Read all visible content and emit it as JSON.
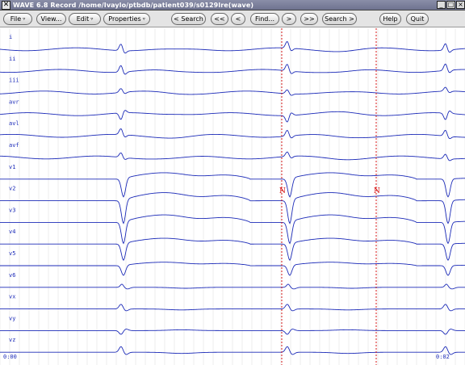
{
  "window": {
    "title": "WAVE 6.8  Record /home/Ivaylo/ptbdb/patient039/s0129lre(wave)",
    "app_icon": "x-logo-icon",
    "controls": [
      "minimize-icon",
      "maximize-icon",
      "close-icon"
    ]
  },
  "toolbar": {
    "file": "File",
    "view": "View...",
    "edit": "Edit",
    "properties": "Properties",
    "search_back": "< Search",
    "back_fast": "<<",
    "back": "<",
    "find": "Find...",
    "forward": ">",
    "forward_fast": ">>",
    "search_forward": "Search >",
    "help": "Help",
    "quit": "Quit",
    "menu_indicator": "▿"
  },
  "signals": {
    "names": [
      "i",
      "ii",
      "iii",
      "avr",
      "avl",
      "avf",
      "v1",
      "v2",
      "v3",
      "v4",
      "v5",
      "v6",
      "vx",
      "vy",
      "vz"
    ],
    "trace_color": "#1c2bb8",
    "grid_color": "#c8c8c8",
    "marker_color": "#d40000"
  },
  "time": {
    "start": "0:00",
    "end": "0:02"
  },
  "annotations": [
    {
      "label": "N"
    },
    {
      "label": "N"
    }
  ]
}
